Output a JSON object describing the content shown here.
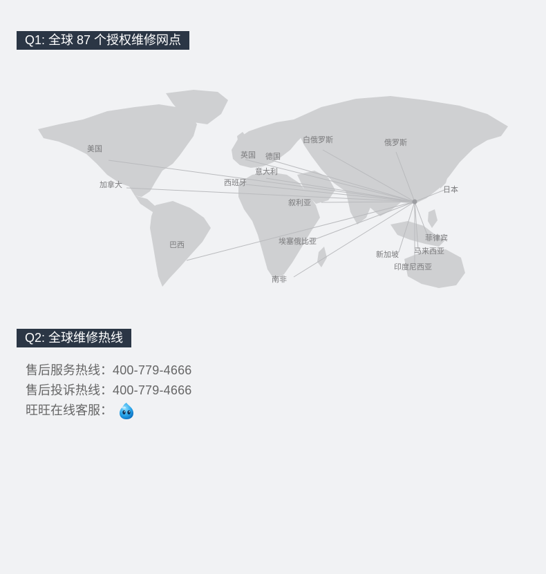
{
  "q1": {
    "title": "Q1: 全球 87 个授权维修网点"
  },
  "map": {
    "hub_city": "中国",
    "cities": [
      {
        "key": "usa",
        "label": "美国"
      },
      {
        "key": "canada",
        "label": "加拿大"
      },
      {
        "key": "uk",
        "label": "英国"
      },
      {
        "key": "germany",
        "label": "德国"
      },
      {
        "key": "italy",
        "label": "意大利"
      },
      {
        "key": "spain",
        "label": "西班牙"
      },
      {
        "key": "belarus",
        "label": "白俄罗斯"
      },
      {
        "key": "russia",
        "label": "俄罗斯"
      },
      {
        "key": "japan",
        "label": "日本"
      },
      {
        "key": "syria",
        "label": "叙利亚"
      },
      {
        "key": "brazil",
        "label": "巴西"
      },
      {
        "key": "ethiopia",
        "label": "埃塞俄比亚"
      },
      {
        "key": "south_africa",
        "label": "南非"
      },
      {
        "key": "philippines",
        "label": "菲律宾"
      },
      {
        "key": "malaysia",
        "label": "马来西亚"
      },
      {
        "key": "singapore",
        "label": "新加坡"
      },
      {
        "key": "indonesia",
        "label": "印度尼西亚"
      }
    ]
  },
  "q2": {
    "title": "Q2: 全球维修热线"
  },
  "hotlines": {
    "service_label": "售后服务热线：",
    "service_value": "400-779-4666",
    "complaint_label": "售后投诉热线：",
    "complaint_value": "400-779-4666",
    "online_label": "旺旺在线客服："
  },
  "icons": {
    "online_service": "aliwangwang-icon"
  },
  "colors": {
    "title_bg": "#2b3645",
    "land": "#cfd0d2",
    "page_bg": "#f1f2f4"
  }
}
